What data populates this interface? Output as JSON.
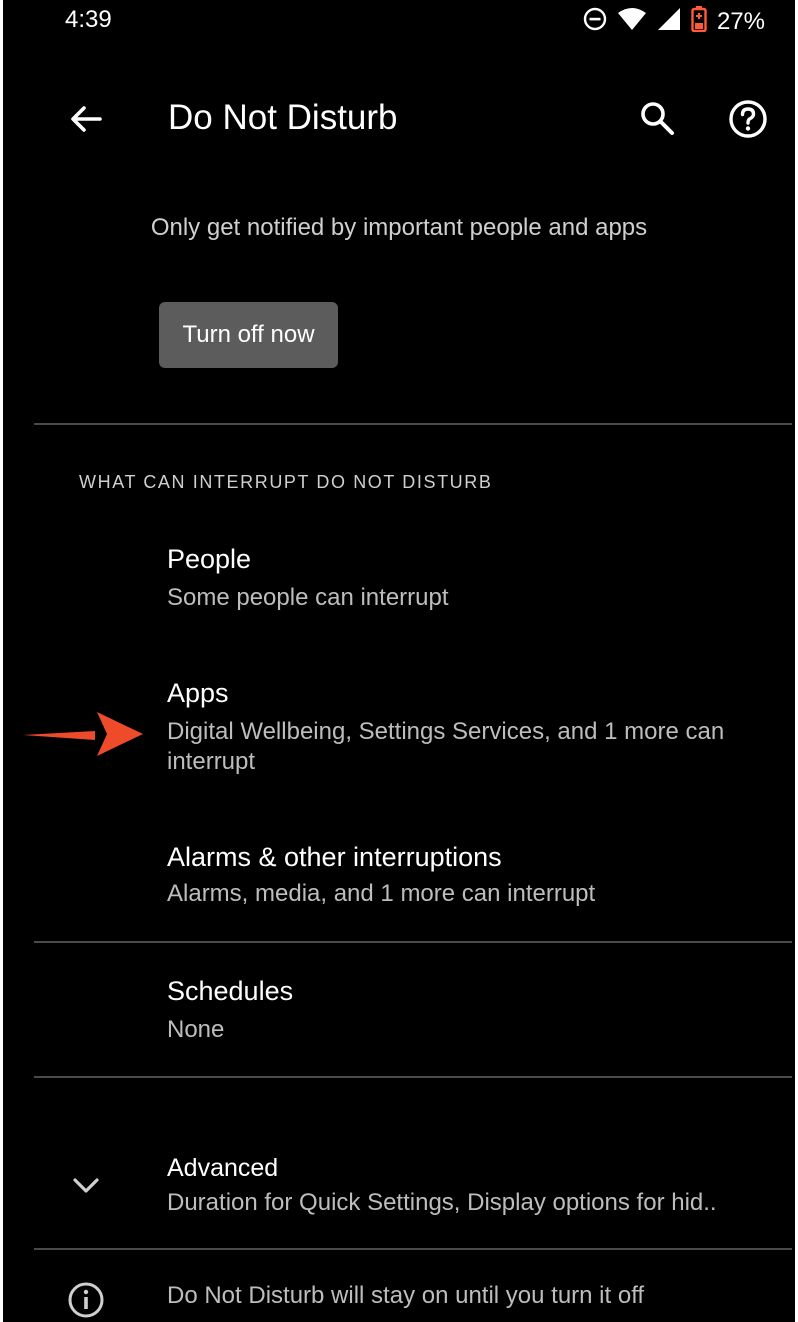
{
  "status_bar": {
    "time": "4:39",
    "battery": "27%",
    "icons": [
      "dnd-icon",
      "wifi-icon",
      "signal-icon",
      "battery-icon"
    ],
    "battery_color": "#ff5a3c"
  },
  "app_bar": {
    "title": "Do Not Disturb",
    "icons": [
      "back-arrow-icon",
      "search-icon",
      "help-icon"
    ]
  },
  "intro": {
    "description": "Only get notified by important people and apps",
    "button_label": "Turn off now"
  },
  "section": {
    "header": "WHAT CAN INTERRUPT DO NOT DISTURB",
    "items": [
      {
        "title": "People",
        "summary": "Some people can interrupt"
      },
      {
        "title": "Apps",
        "summary": "Digital Wellbeing, Settings Services, and 1 more can interrupt"
      },
      {
        "title": "Alarms & other interruptions",
        "summary": "Alarms, media, and 1 more can interrupt"
      }
    ]
  },
  "schedules": {
    "title": "Schedules",
    "summary": "None"
  },
  "advanced": {
    "title": "Advanced",
    "summary": "Duration for Quick Settings, Display options for hid..",
    "icon": "chevron-down-icon"
  },
  "footer": {
    "text": "Do Not Disturb will stay on until you turn it off",
    "icon": "info-icon"
  },
  "annotation": {
    "color": "#ee4b2b",
    "icon": "red-arrow-annotation"
  }
}
